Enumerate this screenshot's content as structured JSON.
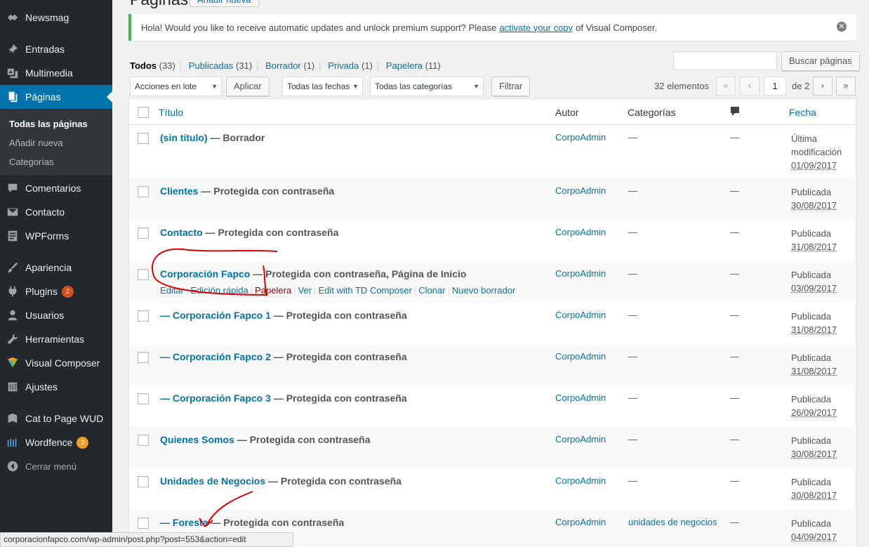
{
  "sidebar": {
    "items": [
      {
        "label": "Newsmag",
        "icon": "newsmag-icon"
      },
      {
        "label": "Entradas",
        "icon": "pin-icon"
      },
      {
        "label": "Multimedia",
        "icon": "media-icon"
      },
      {
        "label": "Páginas",
        "icon": "page-icon"
      },
      {
        "label": "Comentarios",
        "icon": "comment-icon"
      },
      {
        "label": "Contacto",
        "icon": "mail-icon"
      },
      {
        "label": "WPForms",
        "icon": "form-icon"
      },
      {
        "label": "Apariencia",
        "icon": "brush-icon"
      },
      {
        "label": "Plugins",
        "icon": "plug-icon",
        "badge": "2"
      },
      {
        "label": "Usuarios",
        "icon": "user-icon"
      },
      {
        "label": "Herramientas",
        "icon": "wrench-icon"
      },
      {
        "label": "Visual Composer",
        "icon": "vc-icon"
      },
      {
        "label": "Ajustes",
        "icon": "sliders-icon"
      },
      {
        "label": "Cat to Page WUD",
        "icon": "cat-icon"
      },
      {
        "label": "Wordfence",
        "icon": "wordfence-icon",
        "badge": "2"
      },
      {
        "label": "Cerrar menú",
        "icon": "collapse-icon"
      }
    ],
    "submenu": [
      "Todas las páginas",
      "Añadir nueva",
      "Categorías"
    ]
  },
  "header": {
    "title": "Páginas",
    "add_new": "Añadir nueva"
  },
  "notice": {
    "text_before": "Hola! Would you like to receive automatic updates and unlock premium support? Please",
    "link": "activate your copy",
    "text_after": "of Visual Composer."
  },
  "filters": {
    "all": "Todos",
    "all_count": "(33)",
    "published": "Publicadas",
    "published_count": "(31)",
    "draft": "Borrador",
    "draft_count": "(1)",
    "private": "Privada",
    "private_count": "(1)",
    "trash": "Papelera",
    "trash_count": "(11)"
  },
  "search": {
    "button": "Buscar páginas",
    "value": ""
  },
  "bulk": {
    "action": "Acciones en lote",
    "apply": "Aplicar",
    "dates": "Todas las fechas",
    "categories": "Todas las categorías",
    "filter": "Filtrar"
  },
  "pagination": {
    "items": "32 elementos",
    "first": "«",
    "prev": "‹",
    "current": "1",
    "of": "de 2",
    "next": "›",
    "last": "»"
  },
  "table": {
    "headers": {
      "title": "Título",
      "author": "Autor",
      "categories": "Categorías",
      "date": "Fecha"
    },
    "rows": [
      {
        "title": "(sin título)",
        "state": " — Borrador",
        "author": "CorpoAdmin",
        "categories": "—",
        "comments": "—",
        "date_status": "Última modificación",
        "date": "01/09/2017"
      },
      {
        "title": "Clientes",
        "state": " — Protegida con contraseña",
        "author": "CorpoAdmin",
        "categories": "—",
        "comments": "—",
        "date_status": "Publicada",
        "date": "30/08/2017"
      },
      {
        "title": "Contacto",
        "state": " — Protegida con contraseña",
        "author": "CorpoAdmin",
        "categories": "—",
        "comments": "—",
        "date_status": "Publicada",
        "date": "31/08/2017"
      },
      {
        "title": "Corporación Fapco",
        "state": " — Protegida con contraseña, Página de Inicio",
        "author": "CorpoAdmin",
        "categories": "—",
        "comments": "—",
        "date_status": "Publicada",
        "date": "03/09/2017",
        "actions": [
          "Editar",
          "Edición rápida",
          "Papelera",
          "Ver",
          "Edit with TD Composer",
          "Clonar",
          "Nuevo borrador"
        ]
      },
      {
        "title": "— Corporación Fapco 1",
        "state": " — Protegida con contraseña",
        "author": "CorpoAdmin",
        "categories": "—",
        "comments": "—",
        "date_status": "Publicada",
        "date": "31/08/2017"
      },
      {
        "title": "— Corporación Fapco 2",
        "state": " — Protegida con contraseña",
        "author": "CorpoAdmin",
        "categories": "—",
        "comments": "—",
        "date_status": "Publicada",
        "date": "31/08/2017"
      },
      {
        "title": "— Corporación Fapco 3",
        "state": " — Protegida con contraseña",
        "author": "CorpoAdmin",
        "categories": "—",
        "comments": "—",
        "date_status": "Publicada",
        "date": "26/09/2017"
      },
      {
        "title": "Quienes Somos",
        "state": " — Protegida con contraseña",
        "author": "CorpoAdmin",
        "categories": "—",
        "comments": "—",
        "date_status": "Publicada",
        "date": "30/08/2017"
      },
      {
        "title": "Unidades de Negocios",
        "state": " — Protegida con contraseña",
        "author": "CorpoAdmin",
        "categories": "—",
        "comments": "—",
        "date_status": "Publicada",
        "date": "30/08/2017"
      },
      {
        "title": "— Foresta",
        "state": " — Protegida con contraseña",
        "author": "CorpoAdmin",
        "categories": "unidades de negocios",
        "comments": "—",
        "date_status": "Publicada",
        "date": "04/09/2017"
      }
    ]
  },
  "statusbar": {
    "url": "corporacionfapco.com/wp-admin/post.php?post=553&action=edit"
  },
  "colors": {
    "sidebar": "#23282d",
    "active": "#0073aa",
    "link": "#0073aa",
    "notice": "#46b450",
    "annotation": "#e00000"
  }
}
